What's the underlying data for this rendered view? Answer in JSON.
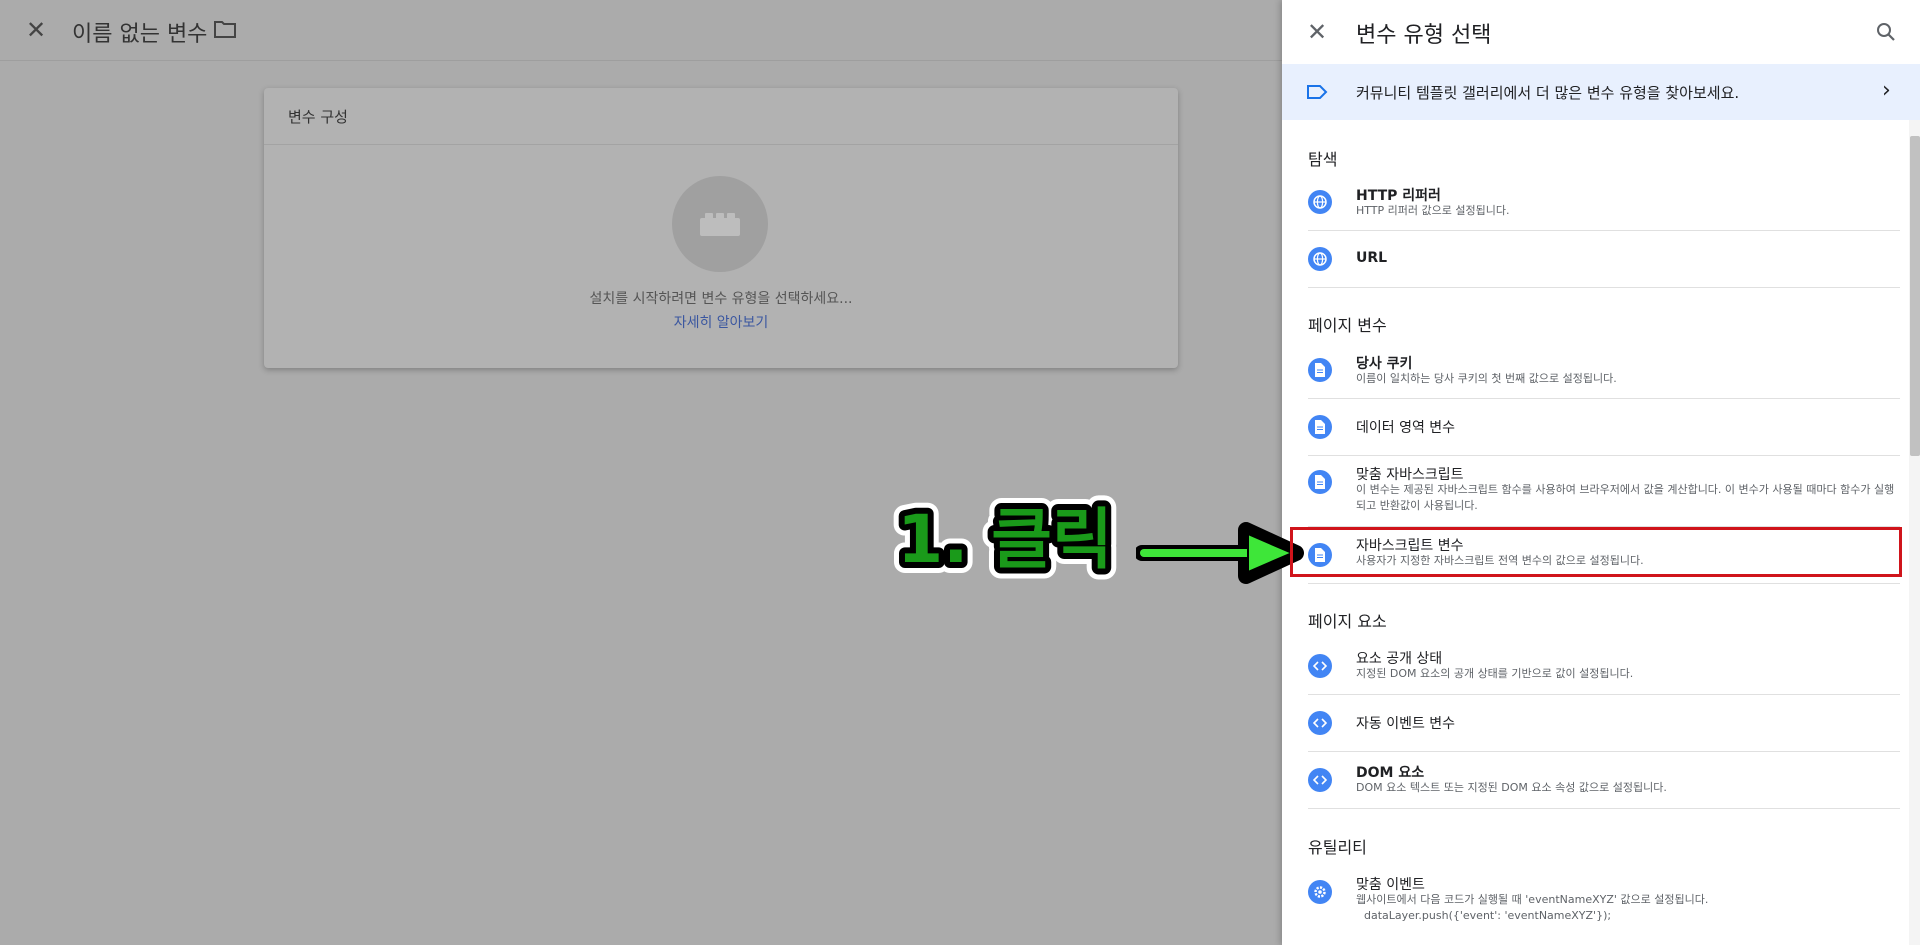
{
  "topbar": {
    "title": "이름 없는 변수"
  },
  "config": {
    "header": "변수 구성",
    "prompt": "설치를 시작하려면 변수 유형을 선택하세요...",
    "learn_more": "자세히 알아보기"
  },
  "panel": {
    "title": "변수 유형 선택",
    "banner": "커뮤니티 템플릿 갤러리에서 더 많은 변수 유형을 찾아보세요.",
    "sections": [
      {
        "title": "탐색",
        "items": [
          {
            "name": "HTTP 리퍼러",
            "desc": "HTTP 리퍼러 값으로 설정됩니다.",
            "icon": "globe-icon"
          },
          {
            "name": "URL",
            "desc": "",
            "icon": "globe-icon"
          }
        ]
      },
      {
        "title": "페이지 변수",
        "items": [
          {
            "name": "당사 쿠키",
            "desc": "이름이 일치하는 당사 쿠키의 첫 번째 값으로 설정됩니다.",
            "icon": "document-icon"
          },
          {
            "name": "데이터 영역 변수",
            "desc": "",
            "icon": "document-icon"
          },
          {
            "name": "맞춤 자바스크립트",
            "desc": "이 변수는 제공된 자바스크립트 함수를 사용하여 브라우저에서 값을 계산합니다. 이 변수가 사용될 때마다 함수가 실행되고 반환값이 사용됩니다.",
            "icon": "document-icon"
          },
          {
            "name": "자바스크립트 변수",
            "desc": "사용자가 지정한 자바스크립트 전역 변수의 값으로 설정됩니다.",
            "icon": "document-icon"
          }
        ]
      },
      {
        "title": "페이지 요소",
        "items": [
          {
            "name": "요소 공개 상태",
            "desc": "지정된 DOM 요소의 공개 상태를 기반으로 값이 설정됩니다.",
            "icon": "code-icon"
          },
          {
            "name": "자동 이벤트 변수",
            "desc": "",
            "icon": "code-icon"
          },
          {
            "name": "DOM 요소",
            "desc": "DOM 요소 텍스트 또는 지정된 DOM 요소 속성 값으로 설정됩니다.",
            "icon": "code-icon"
          }
        ]
      },
      {
        "title": "유틸리티",
        "items": [
          {
            "name": "맞춤 이벤트",
            "desc": "웹사이트에서 다음 코드가 실행될 때 'eventNameXYZ' 값으로 설정됩니다.",
            "desc2": "dataLayer.push({'event': 'eventNameXYZ'});",
            "icon": "gear-icon"
          }
        ]
      }
    ]
  },
  "annotation": {
    "label": "1. 클릭"
  },
  "colors": {
    "accent": "#4285f4",
    "highlight": "#d0141b",
    "arrow": "#3ee639",
    "label_green": "#1a9a1a"
  }
}
